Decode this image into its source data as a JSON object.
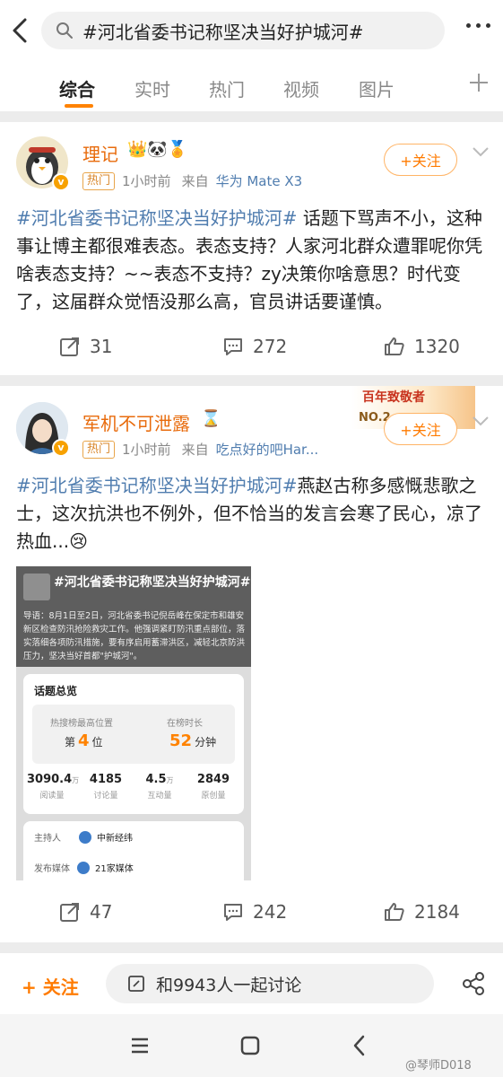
{
  "search": {
    "query": "#河北省委书记称坚决当好护城河#"
  },
  "tabs": [
    "综合",
    "实时",
    "热门",
    "视频",
    "图片"
  ],
  "accent": "#ff8200",
  "posts": [
    {
      "user": "理记",
      "badge": "热门",
      "time": "1小时前",
      "from_label": "来自",
      "source": "华为 Mate X3",
      "follow": "+关注",
      "topic": "#河北省委书记称坚决当好护城河#",
      "text": " 话题下骂声不小，这种事让博主都很难表态。表态支持？人家河北群众遭罪呢你凭啥表态支持？~~表态不支持？zy决策你啥意思？时代变了，这届群众觉悟没那么高，官员讲话要谨慎。",
      "reposts": "31",
      "comments": "272",
      "likes": "1320"
    },
    {
      "user": "军机不可泄露",
      "badge": "热门",
      "time": "1小时前",
      "from_label": "来自",
      "source": "吃点好的吧Har...",
      "follow": "+关注",
      "topic": "#河北省委书记称坚决当好护城河#",
      "text": "燕赵古称多感慨悲歌之士，这次抗洪也不例外，但不恰当的发言会寒了民心，凉了热血...",
      "reposts": "47",
      "comments": "242",
      "likes": "2184",
      "promo": "百年致敬者",
      "promo_no": "NO.2",
      "embed": {
        "title": "#河北省委书记称坚决当好护城河#",
        "desc": "导语：8月1日至2日，河北省委书记倪岳峰在保定市和雄安新区检查防汛抢险救灾工作。他强调紧盯防汛重点部位，落实落细各项防汛措施，要有序启用蓄滞洪区，减轻北京防洪压力，坚决当好首都\"护城河\"。",
        "overview_title": "话题总览",
        "rank_label": "热搜榜最高位置",
        "rank_prefix": "第",
        "rank_value": "4",
        "rank_suffix": "位",
        "duration_label": "在榜时长",
        "duration_value": "52",
        "duration_unit": "分钟",
        "stats": [
          {
            "value": "3090.4",
            "unit": "万",
            "label": "阅读量"
          },
          {
            "value": "4185",
            "unit": "",
            "label": "讨论量"
          },
          {
            "value": "4.5",
            "unit": "万",
            "label": "互动量"
          },
          {
            "value": "2849",
            "unit": "",
            "label": "原创量"
          }
        ],
        "host_label": "主持人",
        "host": "中新经纬",
        "media_label": "发布媒体",
        "media": "21家媒体"
      }
    }
  ],
  "bottom": {
    "follow": "+ 关注",
    "discuss": "和9943人一起讨论"
  },
  "watermark": "@琴师D018"
}
